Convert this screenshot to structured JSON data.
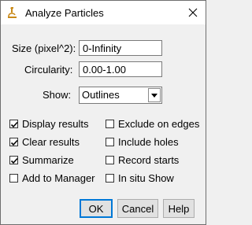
{
  "window": {
    "title": "Analyze Particles",
    "close_icon": "close-icon",
    "app_icon": "microscope-icon"
  },
  "fields": {
    "size": {
      "label": "Size (pixel^2):",
      "value": "0-Infinity"
    },
    "circularity": {
      "label": "Circularity:",
      "value": "0.00-1.00"
    },
    "show": {
      "label": "Show:",
      "value": "Outlines"
    }
  },
  "options": {
    "display_results": {
      "label": "Display results",
      "checked": true
    },
    "clear_results": {
      "label": "Clear results",
      "checked": true
    },
    "summarize": {
      "label": "Summarize",
      "checked": true
    },
    "add_to_manager": {
      "label": "Add to Manager",
      "checked": false
    },
    "exclude_on_edges": {
      "label": "Exclude on edges",
      "checked": false
    },
    "include_holes": {
      "label": "Include holes",
      "checked": false
    },
    "record_starts": {
      "label": "Record starts",
      "checked": false
    },
    "in_situ_show": {
      "label": "In situ Show",
      "checked": false
    }
  },
  "buttons": {
    "ok": "OK",
    "cancel": "Cancel",
    "help": "Help"
  }
}
